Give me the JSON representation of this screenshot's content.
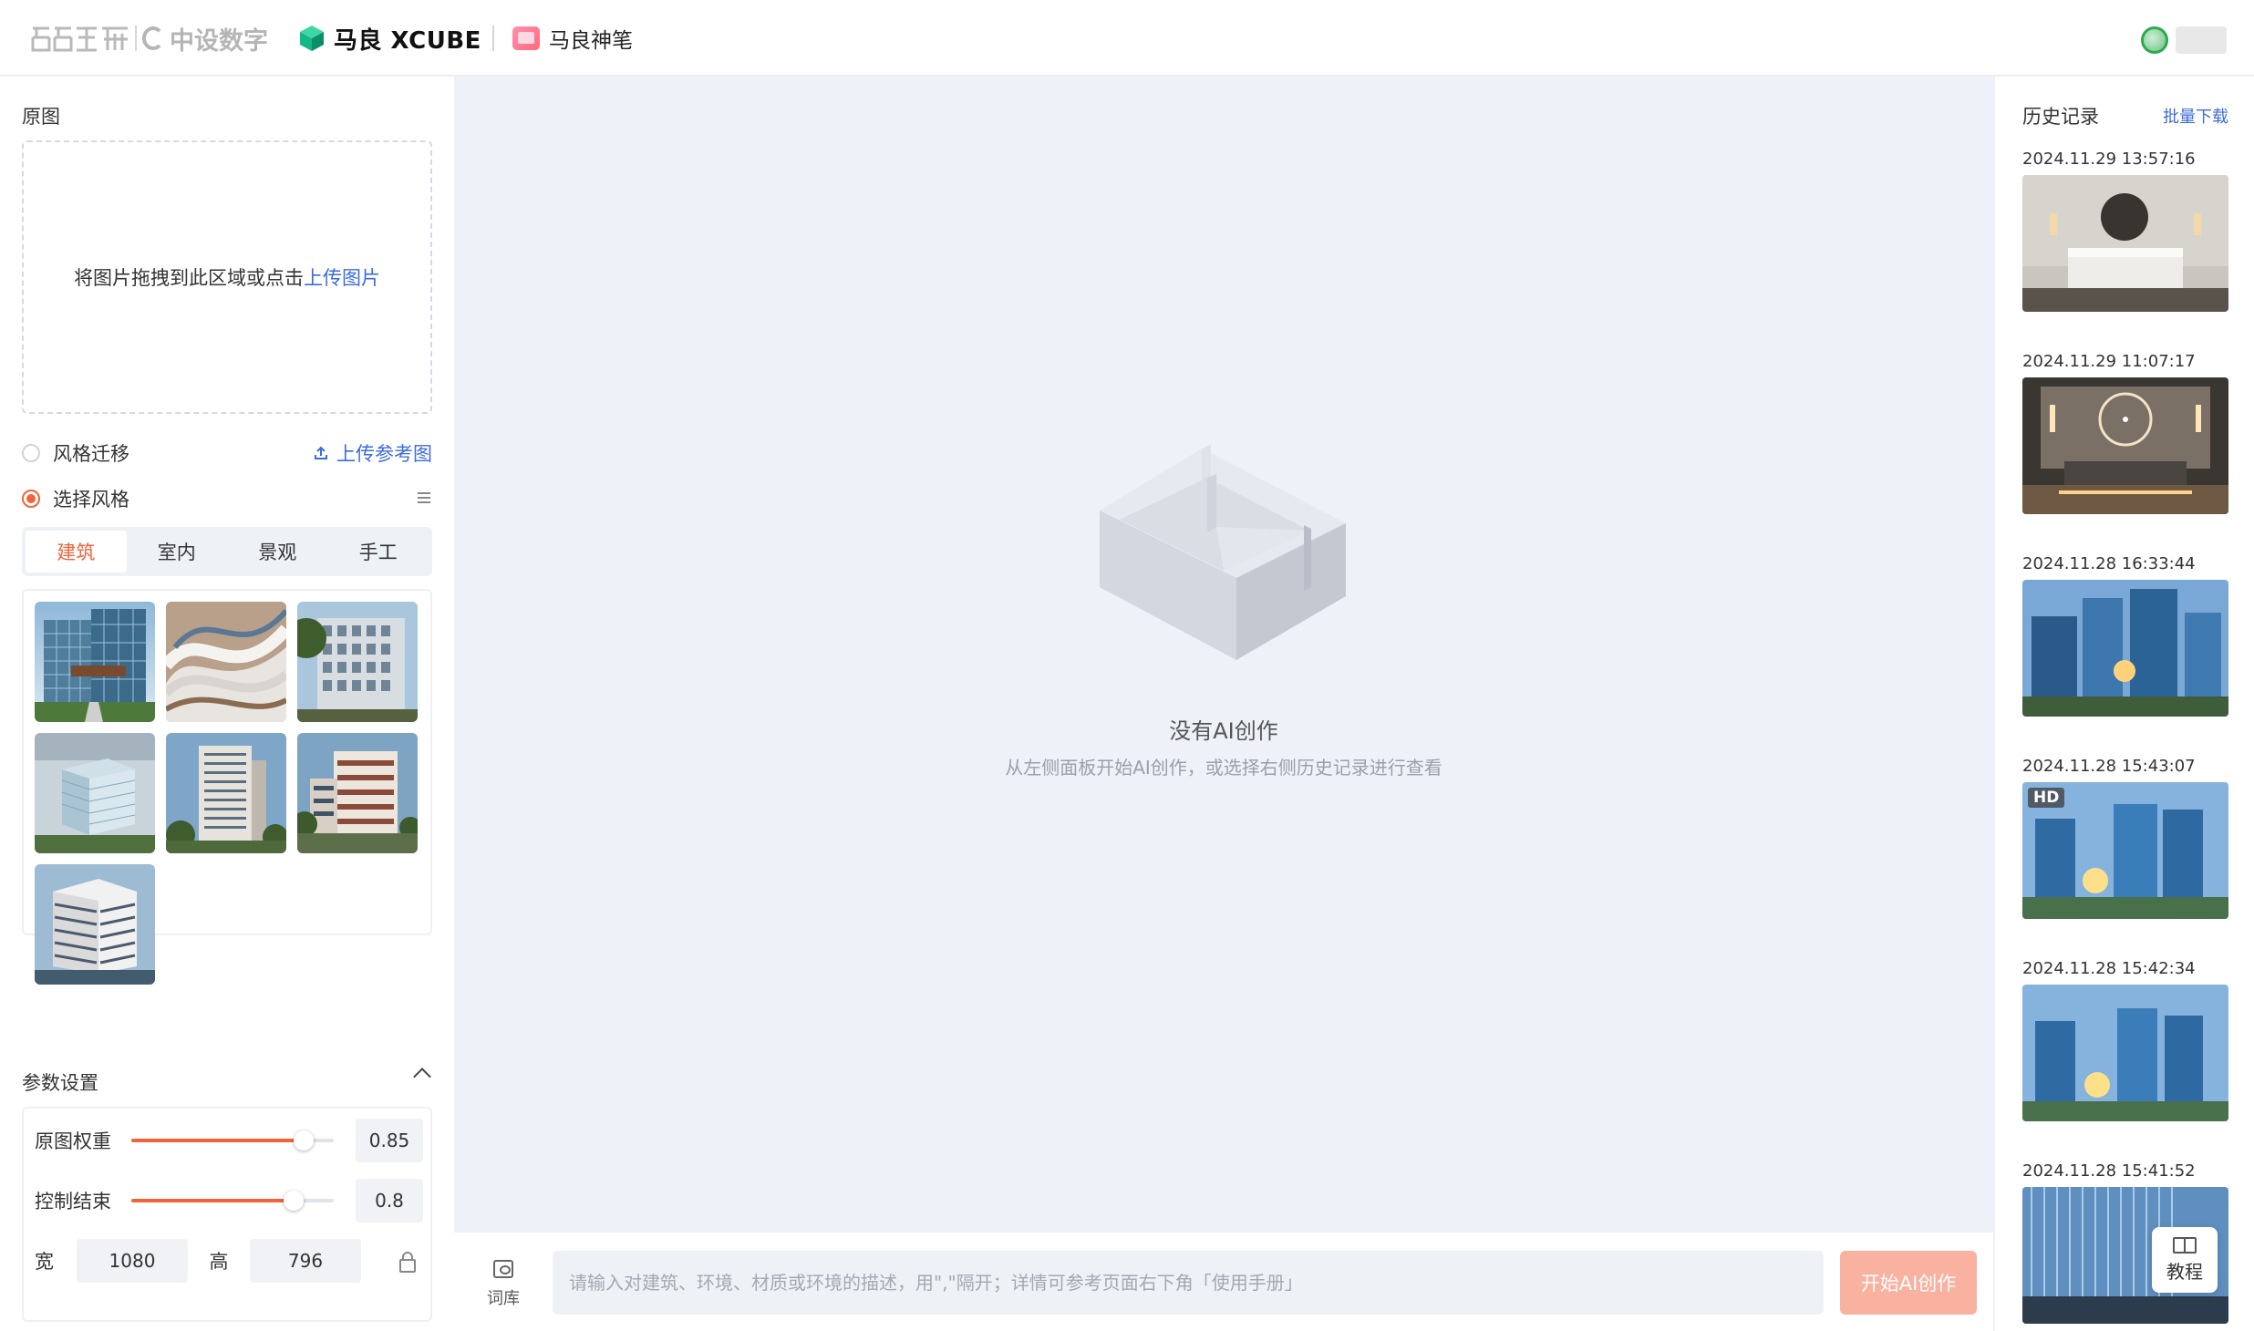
{
  "header": {
    "brand_cscec": "中国建科",
    "brand_zhongshe": "中设数字",
    "brand_xcube": "马良 XCUBE",
    "brand_shenbi": "马良神笔",
    "colors": {
      "xcube_green": "#12b886",
      "accent": "#f0643c",
      "link": "#3d6bdc"
    }
  },
  "left": {
    "original_title": "原图",
    "upload_text": "将图片拖拽到此区域或点击",
    "upload_link": "上传图片",
    "style_transfer_label": "风格迁移",
    "upload_ref_label": "上传参考图",
    "select_style_label": "选择风格",
    "tabs": [
      {
        "label": "建筑",
        "active": true
      },
      {
        "label": "室内",
        "active": false
      },
      {
        "label": "景观",
        "active": false
      },
      {
        "label": "手工",
        "active": false
      }
    ],
    "style_thumbs": [
      {
        "name": "glass-office-building"
      },
      {
        "name": "parametric-curved-building"
      },
      {
        "name": "grid-facade-building"
      },
      {
        "name": "glass-cube-building"
      },
      {
        "name": "residential-tower"
      },
      {
        "name": "terraced-residential"
      },
      {
        "name": "corner-office-tower"
      }
    ],
    "params_title": "参数设置",
    "params": [
      {
        "label": "原图权重",
        "value": "0.85",
        "ratio": 0.85
      },
      {
        "label": "控制结束",
        "value": "0.8",
        "ratio": 0.8
      }
    ],
    "width_label": "宽",
    "width_value": "1080",
    "height_label": "高",
    "height_value": "796"
  },
  "main": {
    "empty_title": "没有AI创作",
    "empty_subtitle": "从左侧面板开始AI创作，或选择右侧历史记录进行查看",
    "ciku_label": "词库",
    "prompt_placeholder": "请输入对建筑、环境、材质或环境的描述，用\",\"隔开；详情可参考页面右下角「使用手册」",
    "start_button": "开始AI创作"
  },
  "history": {
    "title": "历史记录",
    "batch_download": "批量下载",
    "items": [
      {
        "date": "2024.11.29 13:57:16",
        "kind": "bedroom-dark",
        "hd": false
      },
      {
        "date": "2024.11.29 11:07:17",
        "kind": "bedroom-warm",
        "hd": false
      },
      {
        "date": "2024.11.28 16:33:44",
        "kind": "towers-sunset",
        "hd": false
      },
      {
        "date": "2024.11.28 15:43:07",
        "kind": "towers-sunset",
        "hd": true,
        "hd_label": "HD"
      },
      {
        "date": "2024.11.28 15:42:34",
        "kind": "towers-sunset",
        "hd": false
      },
      {
        "date": "2024.11.28 15:41:52",
        "kind": "glass-facade",
        "hd": false
      }
    ],
    "tutorial_label": "教程"
  }
}
